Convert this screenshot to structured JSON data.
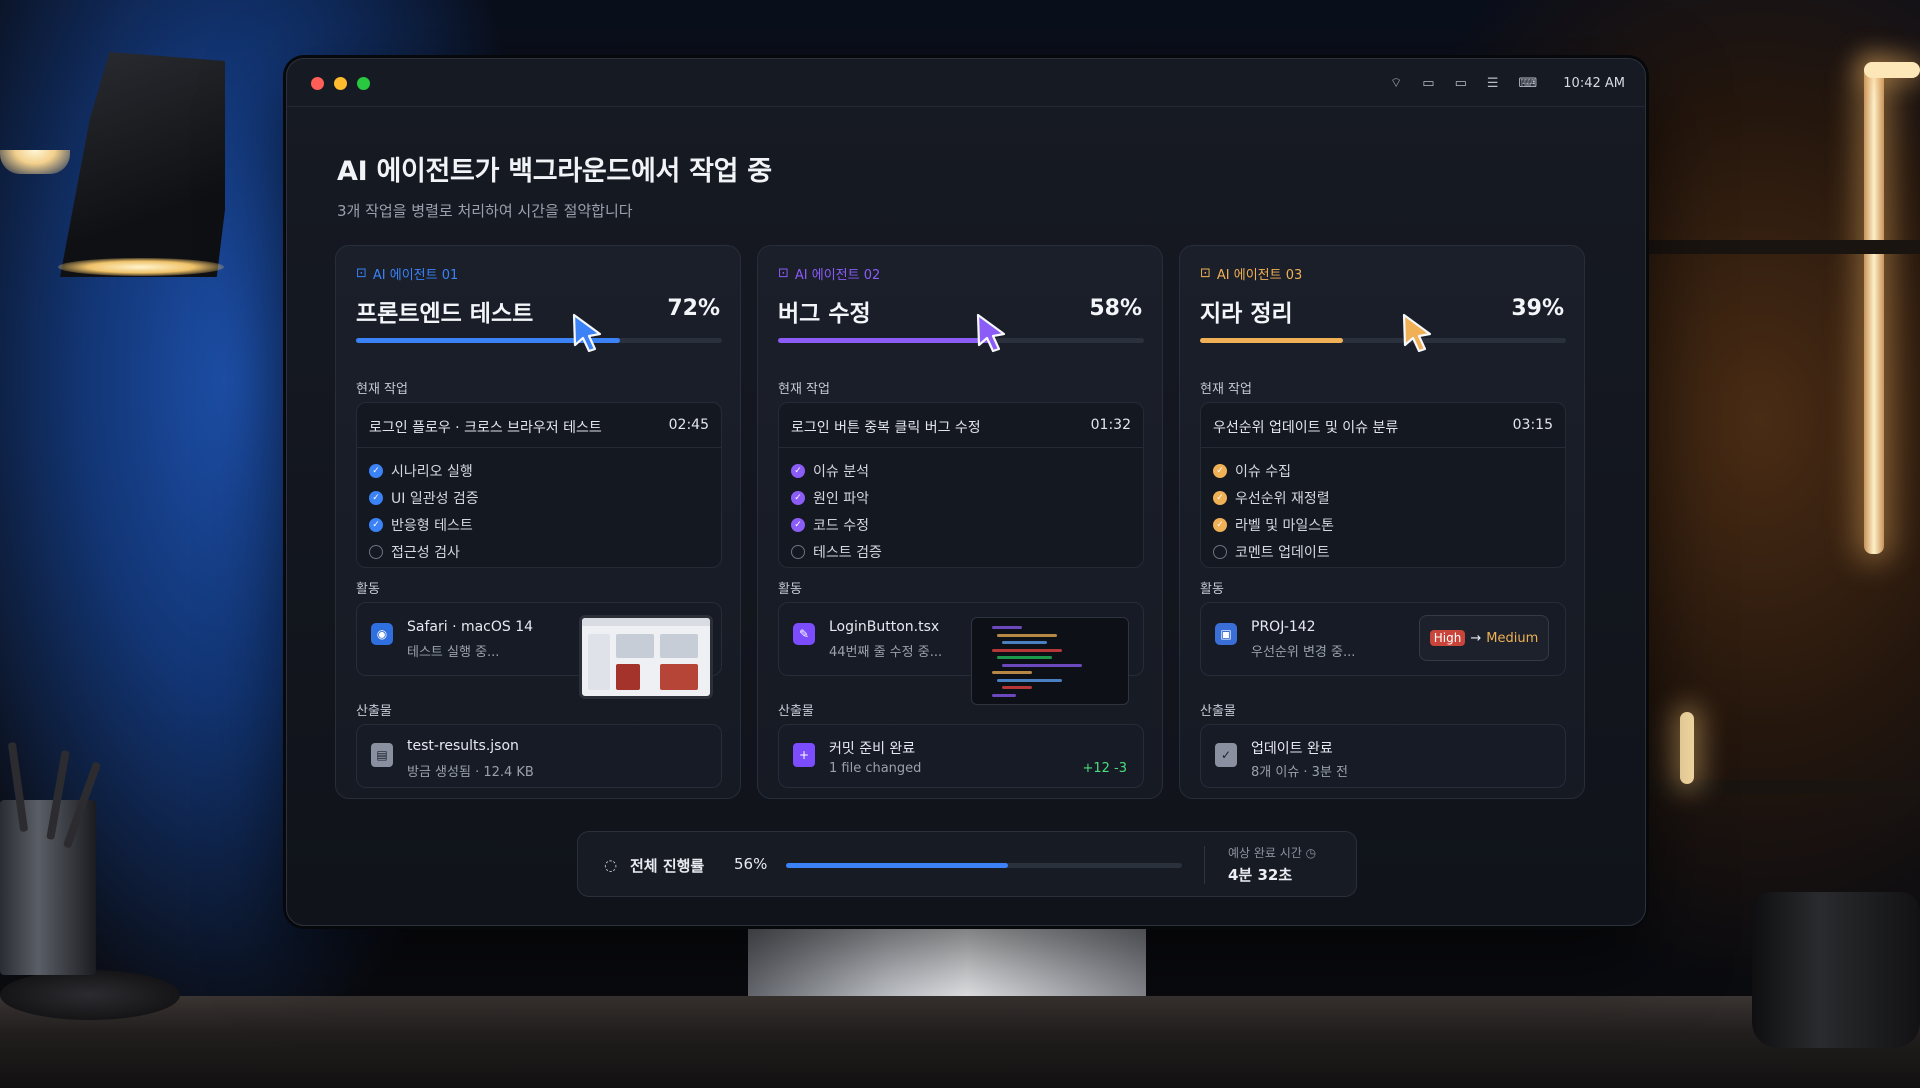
{
  "window": {
    "status_icons": [
      "wifi-icon",
      "battery-icon",
      "display-icon",
      "menu-icon",
      "keyboard-icon"
    ],
    "clock": "10:42 AM"
  },
  "header": {
    "title": "AI 에이전트가 백그라운드에서 작업 중",
    "subtitle": "3개 작업을 병렬로 처리하여 시간을 절약합니다"
  },
  "agents": [
    {
      "tag": "AI 에이전트 01",
      "title": "프론트엔드 테스트",
      "percent_label": "72%",
      "progress": 0.72,
      "accent": "#3b82f6",
      "current_label": "현재 작업",
      "task_title": "로그인 플로우 · 크로스 브라우저 테스트",
      "task_time": "02:45",
      "steps": [
        {
          "label": "시나리오 실행",
          "done": true
        },
        {
          "label": "UI 일관성 검증",
          "done": true
        },
        {
          "label": "반응형 테스트",
          "done": true
        },
        {
          "label": "접근성 검사",
          "done": false
        }
      ],
      "activity_label": "활동",
      "activity_title": "Safari · macOS 14",
      "activity_sub": "테스트 실행 중...",
      "output_label": "산출물",
      "output_title": "test-results.json",
      "output_sub": "방금 생성됨 · 12.4 KB"
    },
    {
      "tag": "AI 에이전트 02",
      "title": "버그 수정",
      "percent_label": "58%",
      "progress": 0.58,
      "accent": "#8b5cf6",
      "current_label": "현재 작업",
      "task_title": "로그인 버튼 중복 클릭 버그 수정",
      "task_time": "01:32",
      "steps": [
        {
          "label": "이슈 분석",
          "done": true
        },
        {
          "label": "원인 파악",
          "done": true
        },
        {
          "label": "코드 수정",
          "done": true
        },
        {
          "label": "테스트 검증",
          "done": false
        }
      ],
      "activity_label": "활동",
      "activity_title": "LoginButton.tsx",
      "activity_sub": "44번째 줄 수정 중...",
      "output_label": "산출물",
      "output_title": "커밋 준비 완료",
      "output_sub": "1 file changed",
      "output_diff": "+12 -3"
    },
    {
      "tag": "AI 에이전트 03",
      "title": "지라 정리",
      "percent_label": "39%",
      "progress": 0.39,
      "accent": "#f0b055",
      "current_label": "현재 작업",
      "task_title": "우선순위 업데이트 및 이슈 분류",
      "task_time": "03:15",
      "steps": [
        {
          "label": "이슈 수집",
          "done": true
        },
        {
          "label": "우선순위 재정렬",
          "done": true
        },
        {
          "label": "라벨 및 마일스톤",
          "done": true
        },
        {
          "label": "코멘트 업데이트",
          "done": false
        }
      ],
      "activity_label": "활동",
      "activity_title": "PROJ-142",
      "activity_sub": "우선순위 변경 중...",
      "priority_from": "High",
      "priority_arrow": "→",
      "priority_to": "Medium",
      "output_label": "산출물",
      "output_title": "업데이트 완료",
      "output_sub": "8개 이슈 · 3분 전"
    }
  ],
  "overall": {
    "label": "전체 진행률",
    "percent_label": "56%",
    "progress": 0.56,
    "eta_label": "예상 완료 시간 ◷",
    "eta_value": "4분 32초"
  }
}
